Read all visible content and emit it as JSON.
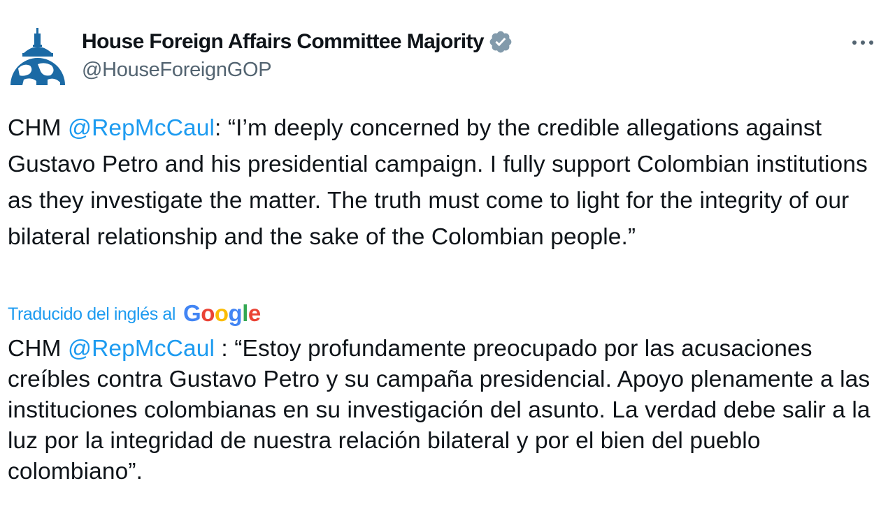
{
  "author": {
    "display_name": "House Foreign Affairs Committee Majority",
    "handle": "@HouseForeignGOP",
    "verified_icon": "verified-badge-icon",
    "avatar_icon": "capitol-dome-globe-icon"
  },
  "menu": {
    "more_icon": "more-horizontal-icon",
    "more_glyph": "···"
  },
  "tweet_en": {
    "prefix": "CHM ",
    "mention": "@RepMcCaul",
    "text": ": “I’m deeply concerned by the credible allegations against Gustavo Petro and his presidential campaign. I fully support Colombian institutions as they investigate the matter. The truth must come to light for the integrity of our bilateral relationship and the sake of the Colombian people.”"
  },
  "translation": {
    "label": "Traducido del inglés al",
    "provider_letters": [
      "G",
      "o",
      "o",
      "g",
      "l",
      "e"
    ]
  },
  "tweet_es": {
    "prefix": "CHM ",
    "mention": "@RepMcCaul",
    "text": " : “Estoy profundamente preocupado por las acusaciones creíbles contra Gustavo Petro y su campaña presidencial. Apoyo plenamente a las instituciones colombianas en su investigación del asunto. La verdad debe salir a la luz por la integridad de nuestra relación bilateral y por el bien del pueblo colombiano”."
  },
  "colors": {
    "link": "#1d9bf0",
    "text": "#0f1419",
    "secondary": "#536471",
    "verified": "#829aab",
    "avatar_blue": "#1b6aa5",
    "google": [
      "#4285f4",
      "#ea4335",
      "#fbbc05",
      "#4285f4",
      "#34a853",
      "#ea4335"
    ]
  }
}
